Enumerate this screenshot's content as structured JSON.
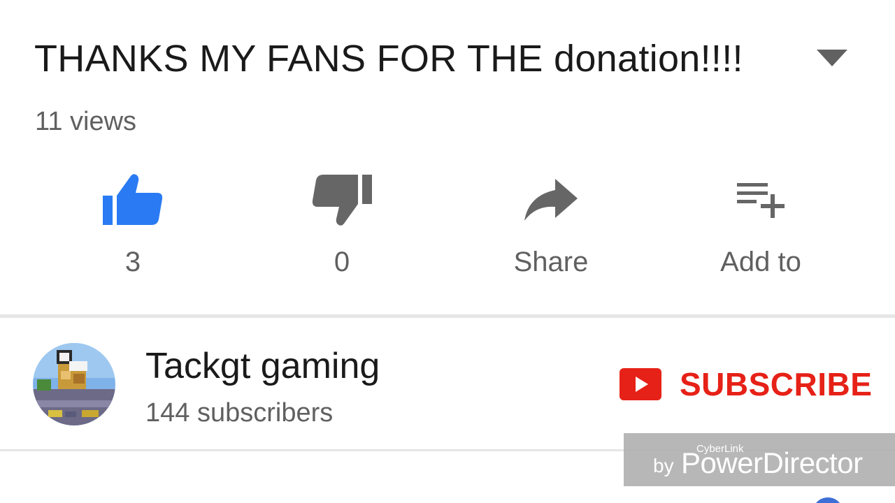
{
  "video": {
    "title": "THANKS MY FANS FOR THE donation!!!!",
    "views": "11 views"
  },
  "actions": {
    "like": {
      "count": "3",
      "icon": "thumb-up-icon",
      "active_color": "#2a7bf3"
    },
    "dislike": {
      "count": "0",
      "icon": "thumb-down-icon"
    },
    "share": {
      "label": "Share",
      "icon": "share-arrow-icon"
    },
    "add": {
      "label": "Add to",
      "icon": "playlist-add-icon"
    }
  },
  "channel": {
    "name": "Tackgt gaming",
    "subscribers": "144 subscribers",
    "subscribe_label": "SUBSCRIBE",
    "subscribe_color": "#e62117"
  },
  "watermark": {
    "small": "CyberLink",
    "by": "by",
    "main": "PowerDirector"
  }
}
